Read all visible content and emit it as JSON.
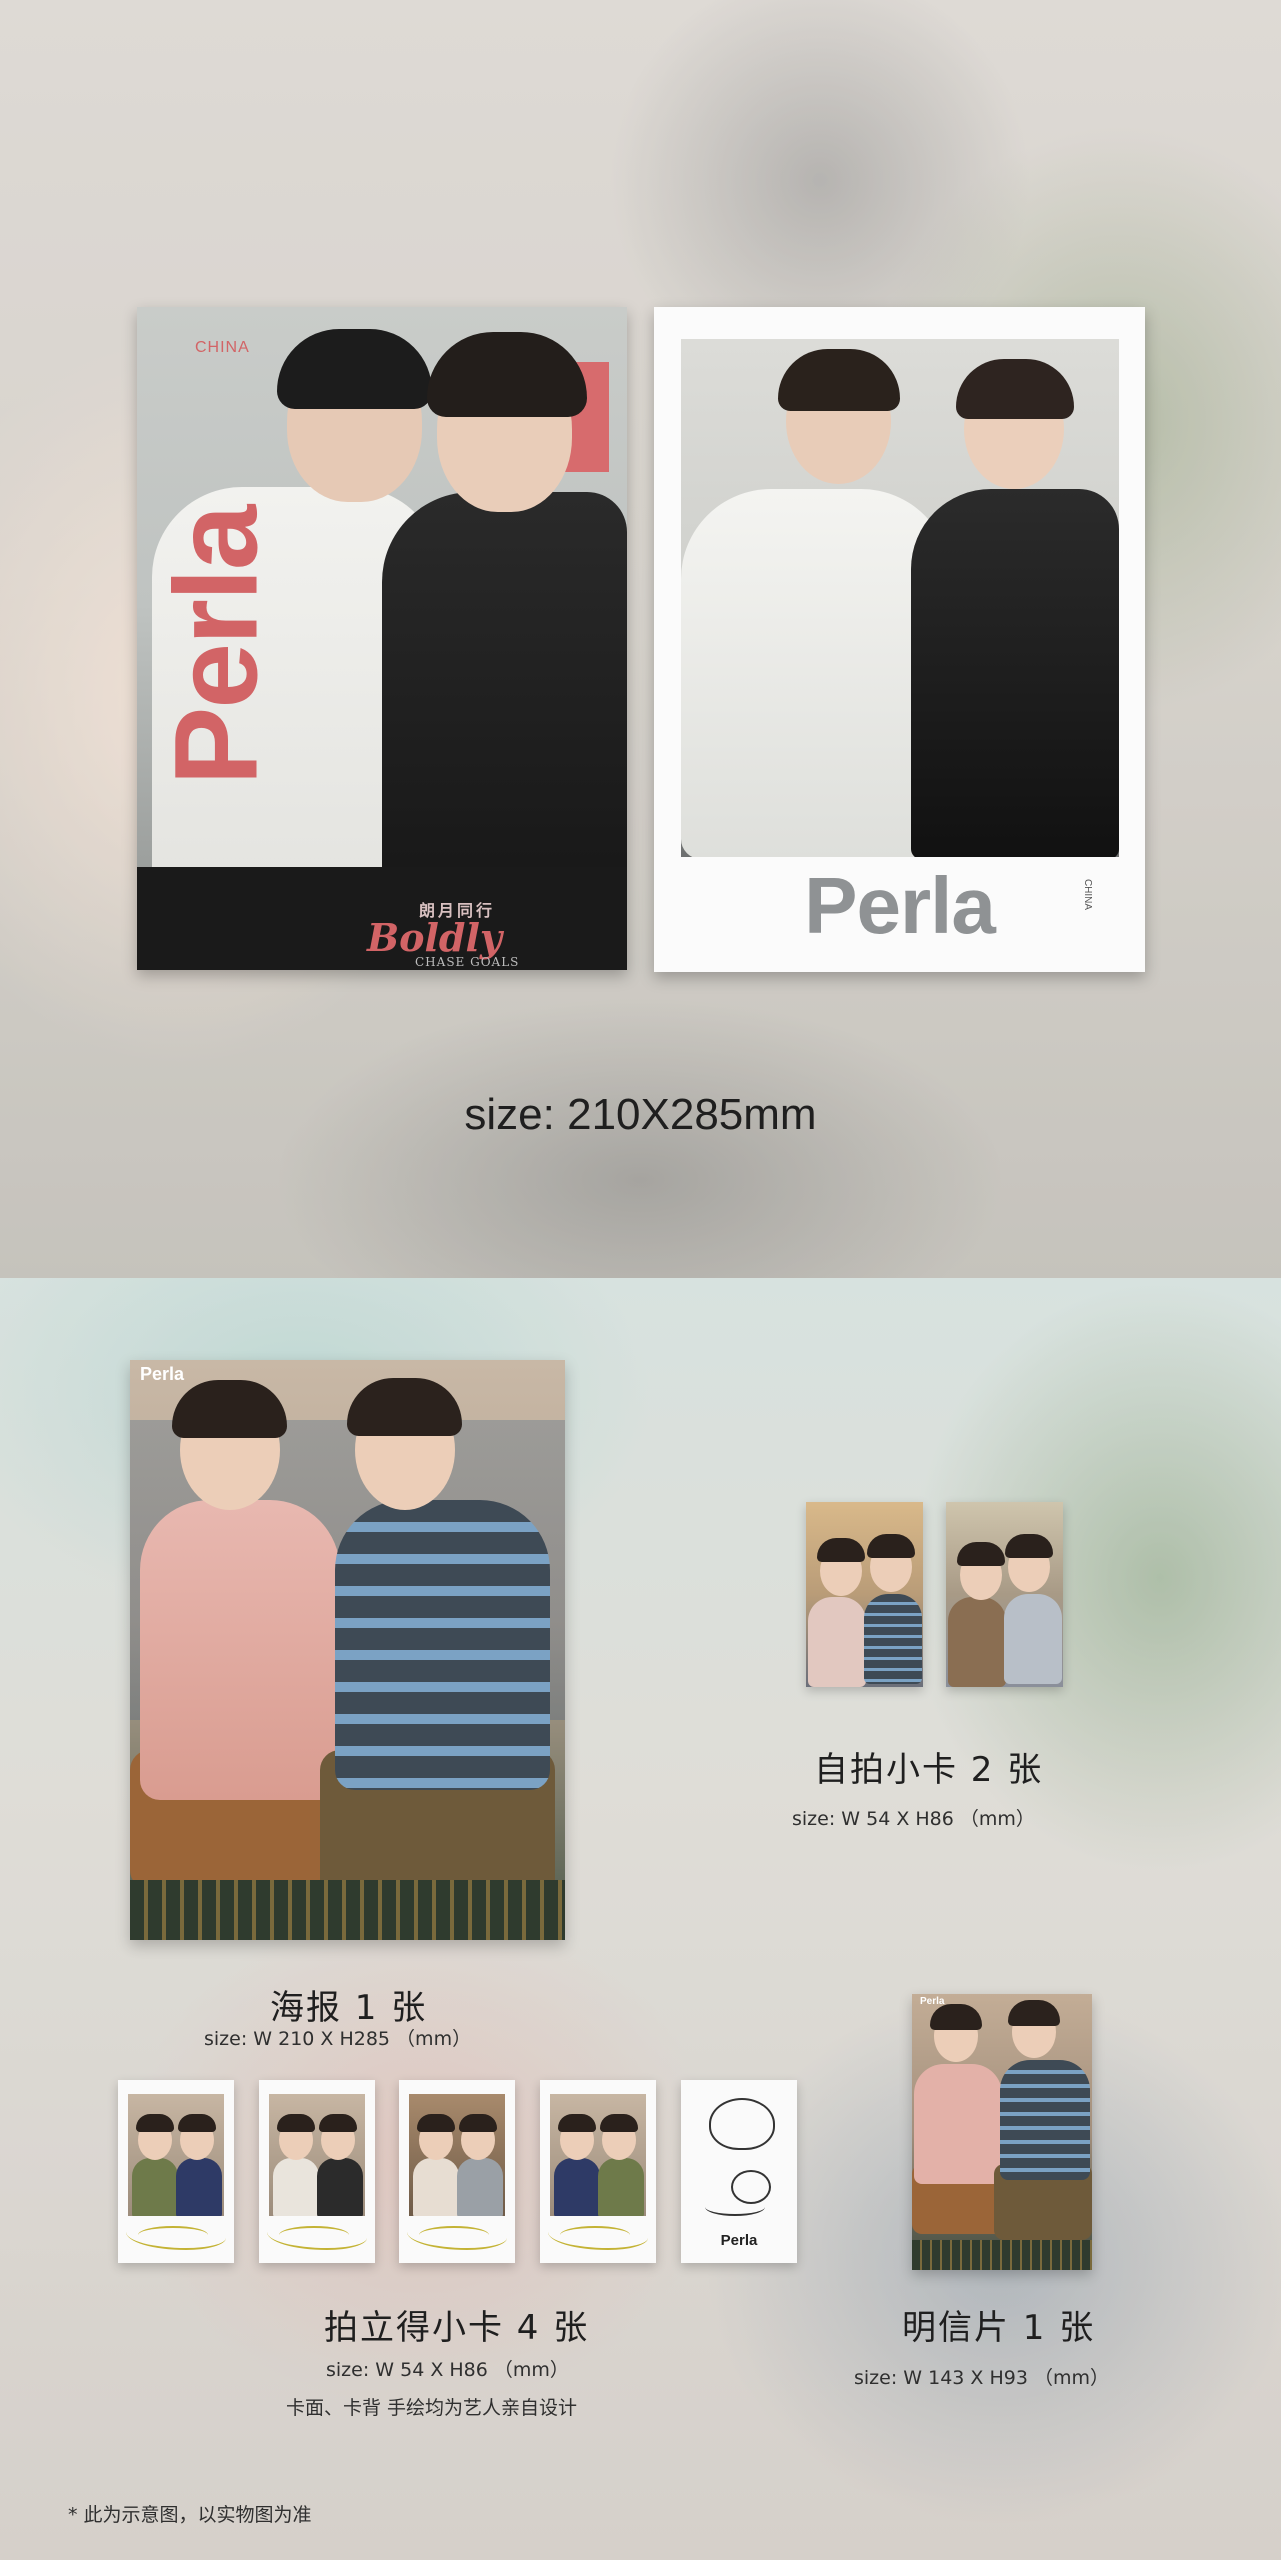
{
  "top": {
    "cover_magazine": {
      "brand": "Perla",
      "brand_sub": "CHINA",
      "title_cn": "朗月同行",
      "title_en": "Boldly",
      "subtitle_en": "CHASE GOALS"
    },
    "cover_polaroid": {
      "brand": "Perla",
      "brand_sub": "CHINA"
    },
    "size_label": "size: 210X285mm"
  },
  "items": {
    "poster": {
      "logo": "Perla",
      "name": "海报 1 张",
      "size": "size: W 210  X  H285 （mm）"
    },
    "selfie_cards": {
      "name": "自拍小卡 2 张",
      "size": "size: W 54  X  H86 （mm）"
    },
    "polaroid_cards": {
      "name": "拍立得小卡 4 张",
      "size": "size: W 54  X  H86 （mm）",
      "note": "卡面、卡背 手绘均为艺人亲自设计",
      "back_logo": "Perla"
    },
    "postcard": {
      "logo": "Perla",
      "name": "明信片 1 张",
      "size": "size: W 143  X  H93 （mm）"
    }
  },
  "footnote": "* 此为示意图，以实物图为准",
  "colors": {
    "brand_pink": "#d26466",
    "signature_gold": "#c4b335"
  }
}
